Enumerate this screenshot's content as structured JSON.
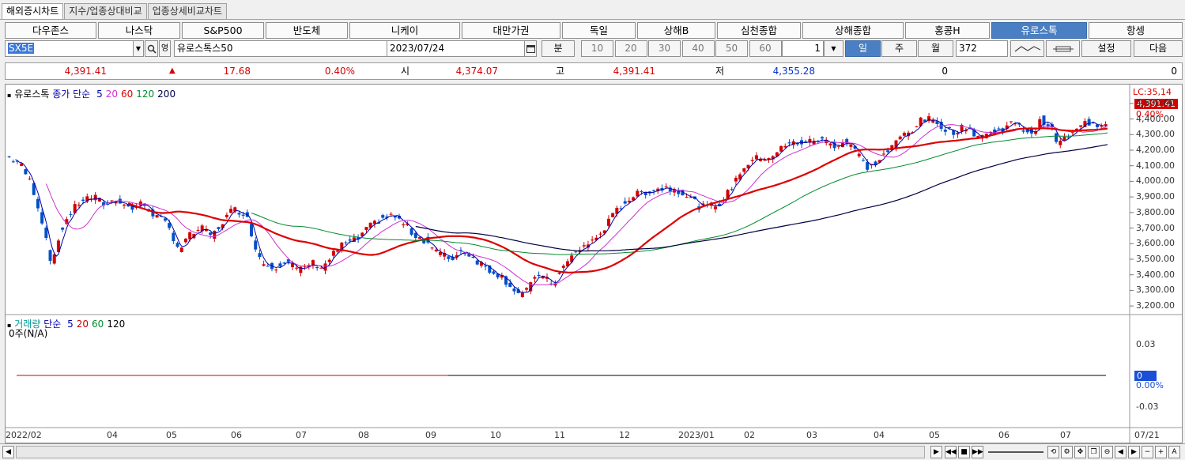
{
  "tabs": [
    {
      "label": "해외증시차트",
      "active": true
    },
    {
      "label": "지수/업종상대비교",
      "active": false
    },
    {
      "label": "업종상세비교차트",
      "active": false
    }
  ],
  "indices": [
    "다우존스",
    "나스닥",
    "S&P500",
    "반도체",
    "니케이",
    "대만가권",
    "독일",
    "상해B",
    "심천종합",
    "상해종합",
    "홍콩H",
    "유로스톡",
    "항셍"
  ],
  "selected_index": "유로스톡",
  "symbol": {
    "code": "SX5E",
    "name": "유로스톡스50",
    "date": "2023/07/24",
    "unit_button": "분",
    "intervals": [
      "10",
      "20",
      "30",
      "40",
      "50",
      "60"
    ],
    "period_value": "1",
    "period_buttons": [
      "일",
      "주",
      "월"
    ],
    "selected_period": "일",
    "count": "372",
    "settings_label": "설정",
    "next_label": "다음",
    "search_icon": "search-icon",
    "calendar_icon": "calendar-icon",
    "kr_toggle": "영"
  },
  "quote": {
    "last": "4,391.41",
    "change": "17.68",
    "change_pct": "0.40%",
    "open_label": "시",
    "open": "4,374.07",
    "high_label": "고",
    "high": "4,391.41",
    "low_label": "저",
    "low": "4,355.28",
    "volume": "0",
    "amount": "0"
  },
  "price_legend": {
    "name": "유로스톡",
    "type": "종가 단순",
    "periods": [
      {
        "p": "5",
        "color": "#0000aa"
      },
      {
        "p": "20",
        "color": "#cc33cc"
      },
      {
        "p": "60",
        "color": "#dd0000"
      },
      {
        "p": "120",
        "color": "#008a2e"
      },
      {
        "p": "200",
        "color": "#000044"
      }
    ]
  },
  "volume_legend": {
    "name": "거래량",
    "type": "단순",
    "periods": [
      {
        "p": "5",
        "color": "#0000aa"
      },
      {
        "p": "20",
        "color": "#cc0000"
      },
      {
        "p": "60",
        "color": "#008a2e"
      },
      {
        "p": "120",
        "color": "#000000"
      }
    ],
    "na_text": "0주(N/A)"
  },
  "lc_label": "LC:35,14",
  "last_badge": "4,391.41",
  "pct_badge": "0.40%",
  "vol_badge": "0",
  "vol_pct_badge": "0.00%",
  "colors": {
    "up": "#d40000",
    "down": "#0050c8",
    "accent": "#4a7fc4"
  },
  "chart_data": {
    "type": "candlestick",
    "y_ticks": [
      "4,500.00",
      "4,400.00",
      "4,300.00",
      "4,200.00",
      "4,100.00",
      "4,000.00",
      "3,900.00",
      "3,800.00",
      "3,700.00",
      "3,600.00",
      "3,500.00",
      "3,400.00",
      "3,300.00",
      "3,200.00"
    ],
    "ylim": [
      3160,
      4560
    ],
    "volume_ticks": [
      "0.03",
      "-0.03"
    ],
    "x_ticks": [
      "2022/02",
      "04",
      "05",
      "06",
      "07",
      "08",
      "09",
      "10",
      "11",
      "12",
      "2023/01",
      "02",
      "03",
      "04",
      "05",
      "06",
      "07",
      "07/21"
    ],
    "close_path": [
      [
        0,
        4160
      ],
      [
        6,
        4120
      ],
      [
        12,
        3980
      ],
      [
        18,
        3700
      ],
      [
        22,
        3450
      ],
      [
        26,
        3680
      ],
      [
        30,
        3780
      ],
      [
        36,
        3880
      ],
      [
        42,
        3900
      ],
      [
        48,
        3850
      ],
      [
        54,
        3890
      ],
      [
        60,
        3820
      ],
      [
        66,
        3860
      ],
      [
        72,
        3780
      ],
      [
        78,
        3720
      ],
      [
        84,
        3560
      ],
      [
        88,
        3640
      ],
      [
        94,
        3700
      ],
      [
        100,
        3650
      ],
      [
        106,
        3760
      ],
      [
        110,
        3820
      ],
      [
        116,
        3800
      ],
      [
        120,
        3620
      ],
      [
        124,
        3480
      ],
      [
        130,
        3450
      ],
      [
        136,
        3500
      ],
      [
        142,
        3420
      ],
      [
        148,
        3480
      ],
      [
        154,
        3450
      ],
      [
        158,
        3520
      ],
      [
        164,
        3600
      ],
      [
        170,
        3620
      ],
      [
        176,
        3700
      ],
      [
        182,
        3760
      ],
      [
        188,
        3780
      ],
      [
        194,
        3720
      ],
      [
        198,
        3660
      ],
      [
        204,
        3620
      ],
      [
        210,
        3540
      ],
      [
        216,
        3500
      ],
      [
        222,
        3560
      ],
      [
        228,
        3500
      ],
      [
        234,
        3440
      ],
      [
        240,
        3400
      ],
      [
        246,
        3320
      ],
      [
        250,
        3270
      ],
      [
        254,
        3300
      ],
      [
        258,
        3420
      ],
      [
        262,
        3370
      ],
      [
        266,
        3340
      ],
      [
        270,
        3430
      ],
      [
        274,
        3500
      ],
      [
        280,
        3580
      ],
      [
        286,
        3620
      ],
      [
        292,
        3720
      ],
      [
        298,
        3830
      ],
      [
        304,
        3900
      ],
      [
        310,
        3930
      ],
      [
        316,
        3950
      ],
      [
        322,
        3960
      ],
      [
        328,
        3940
      ],
      [
        334,
        3880
      ],
      [
        338,
        3830
      ],
      [
        342,
        3840
      ],
      [
        346,
        3850
      ],
      [
        350,
        3900
      ],
      [
        354,
        3990
      ],
      [
        358,
        4080
      ],
      [
        362,
        4130
      ],
      [
        366,
        4150
      ],
      [
        372,
        4160
      ],
      [
        378,
        4220
      ],
      [
        384,
        4250
      ],
      [
        390,
        4250
      ],
      [
        396,
        4270
      ],
      [
        400,
        4250
      ],
      [
        404,
        4230
      ],
      [
        408,
        4260
      ],
      [
        412,
        4230
      ],
      [
        416,
        4140
      ],
      [
        420,
        4080
      ],
      [
        424,
        4130
      ],
      [
        428,
        4180
      ],
      [
        432,
        4230
      ],
      [
        436,
        4300
      ],
      [
        440,
        4320
      ],
      [
        444,
        4380
      ],
      [
        448,
        4400
      ],
      [
        452,
        4380
      ],
      [
        456,
        4350
      ],
      [
        460,
        4320
      ],
      [
        464,
        4330
      ],
      [
        468,
        4360
      ],
      [
        472,
        4290
      ],
      [
        476,
        4300
      ],
      [
        480,
        4310
      ],
      [
        484,
        4330
      ],
      [
        488,
        4380
      ],
      [
        492,
        4350
      ],
      [
        496,
        4330
      ],
      [
        500,
        4310
      ],
      [
        504,
        4400
      ],
      [
        508,
        4350
      ],
      [
        512,
        4240
      ],
      [
        516,
        4280
      ],
      [
        520,
        4310
      ],
      [
        524,
        4370
      ],
      [
        528,
        4380
      ],
      [
        532,
        4360
      ],
      [
        536,
        4391
      ]
    ],
    "ma5_color": "#0000aa",
    "ma20_color": "#cc33cc",
    "ma60_color": "#dd0000",
    "ma120_color": "#008a2e",
    "ma200_color": "#000044"
  }
}
